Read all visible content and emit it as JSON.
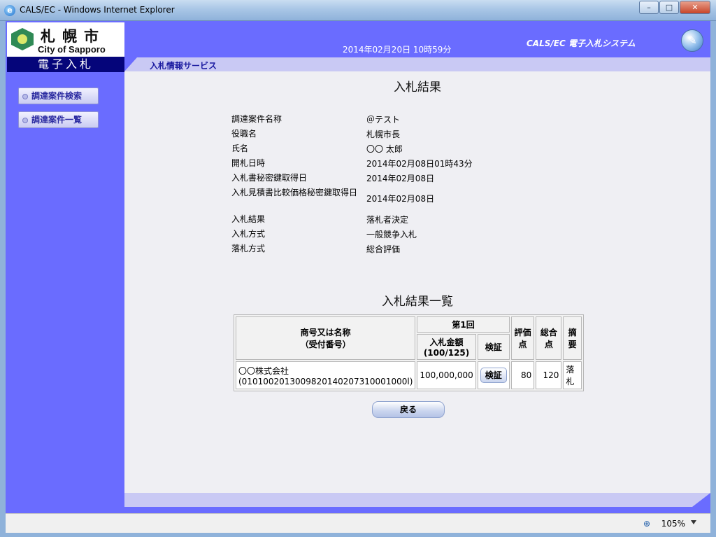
{
  "window": {
    "title": "CALS/EC - Windows Internet Explorer",
    "icon": "ie-icon",
    "minimize": "–",
    "maximize": "□",
    "close": "✕"
  },
  "header": {
    "city_kanji": "札幌市",
    "city_en": "City of Sapporo",
    "band": "電子入札",
    "datetime": "2014年02月20日 10時59分",
    "system_name": "CALS/EC 電子入札システム",
    "service": "入札情報サービス"
  },
  "sidebar": {
    "items": [
      {
        "label": "調達案件検索"
      },
      {
        "label": "調達案件一覧"
      }
    ]
  },
  "main": {
    "title": "入札結果",
    "info": [
      {
        "label": "調達案件名称",
        "value": "＠テスト"
      },
      {
        "label": "役職名",
        "value": "札幌市長"
      },
      {
        "label": "氏名",
        "value": "〇〇 太郎"
      },
      {
        "label": "開札日時",
        "value": "2014年02月08日01時43分"
      },
      {
        "label": "入札書秘密鍵取得日",
        "value": "2014年02月08日"
      },
      {
        "label": "入札見積書比較価格秘密鍵取得日",
        "value": "2014年02月08日"
      },
      {
        "label": "入札結果",
        "value": "落札者決定"
      },
      {
        "label": "入札方式",
        "value": "一般競争入札"
      },
      {
        "label": "落札方式",
        "value": "総合評価"
      }
    ],
    "list_title": "入札結果一覧",
    "table": {
      "col_name": "商号又は名称",
      "col_name_sub": "（受付番号）",
      "col_round": "第1回",
      "col_amount": "入札金額",
      "col_amount_sub": "(100/125)",
      "col_verify": "検証",
      "col_eval": "評価点",
      "col_total": "総合点",
      "col_note": "摘要",
      "rows": [
        {
          "name": "〇〇株式会社",
          "receipt": "(0101002013009820140207310001000l)",
          "amount": "100,000,000",
          "verify": "検証",
          "eval": "80",
          "total": "120",
          "note": "落札"
        }
      ]
    },
    "back_label": "戻る"
  },
  "status": {
    "zoom": "105%",
    "zoom_icon": "zoom-icon"
  }
}
